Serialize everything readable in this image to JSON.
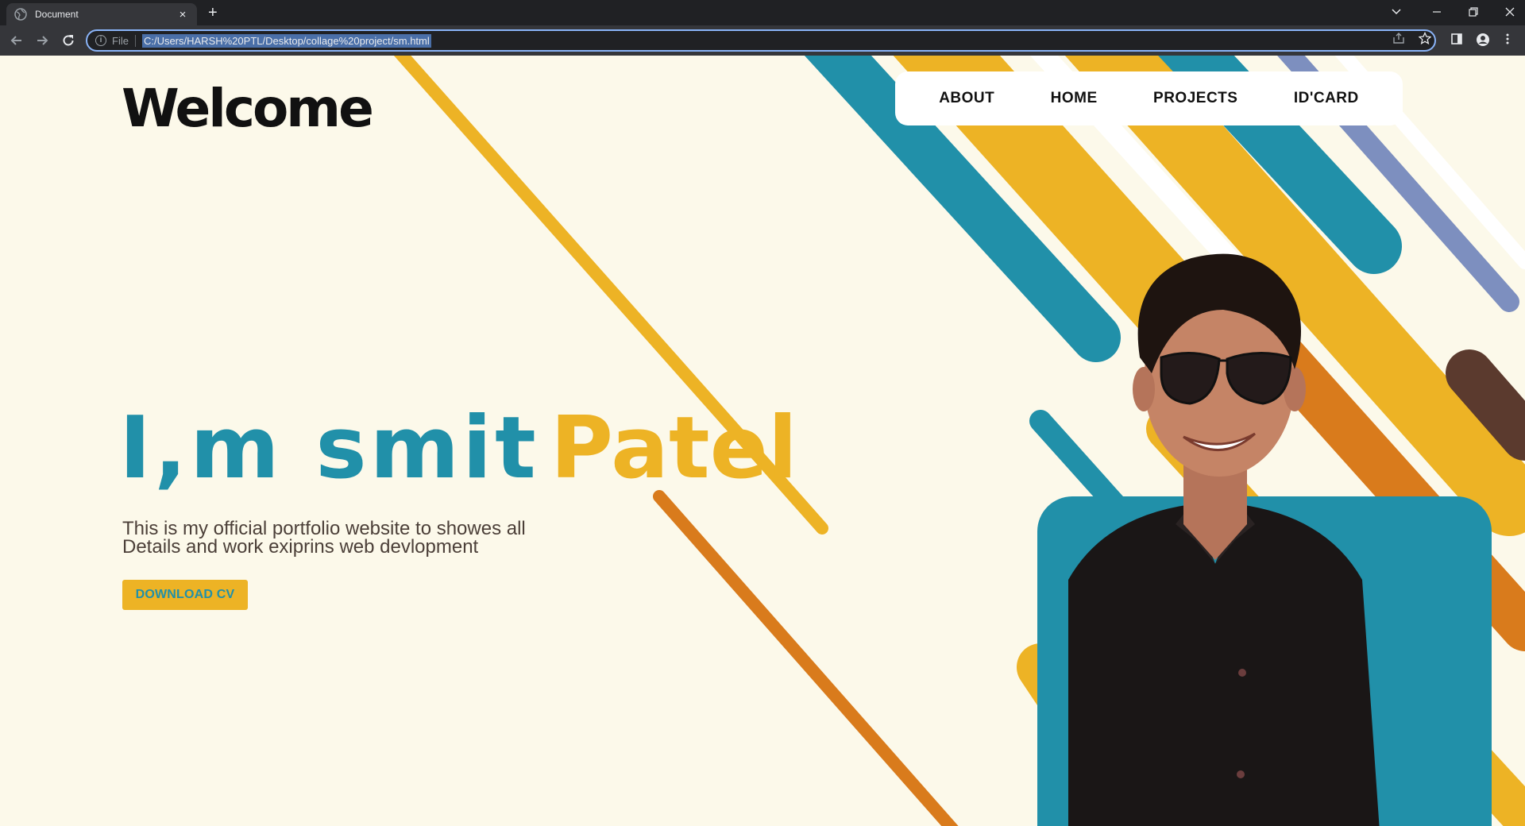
{
  "browser": {
    "tab_title": "Document",
    "tab_close": "×",
    "new_tab": "+",
    "file_label": "File",
    "url": "C:/Users/HARSH%20PTL/Desktop/collage%20project/sm.html"
  },
  "header": {
    "logo_text": "Welcome",
    "nav": [
      {
        "label": "ABOUT"
      },
      {
        "label": "HOME"
      },
      {
        "label": "PROJECTS"
      },
      {
        "label": "ID'CARD"
      }
    ]
  },
  "hero": {
    "title_first": "I,m smit",
    "title_last": "Patel",
    "tagline_line1": "This is my official portfolio website to showes all",
    "tagline_line2": "Details and work exiprins web devlopment",
    "cta_label": "DOWNLOAD CV"
  },
  "colors": {
    "page_bg": "#fcf9ea",
    "yellow": "#edb325",
    "teal": "#2190a9",
    "orange": "#d97b1c",
    "brown": "#5b3a2e"
  },
  "icons": {
    "tab": "globe-icon",
    "back": "arrow-left-icon",
    "forward": "arrow-right-icon",
    "reload": "reload-icon",
    "info": "info-icon",
    "share": "share-icon",
    "bookmark": "star-icon",
    "sidepanel": "sidepanel-icon",
    "profile": "profile-icon",
    "menu": "kebab-menu-icon"
  }
}
